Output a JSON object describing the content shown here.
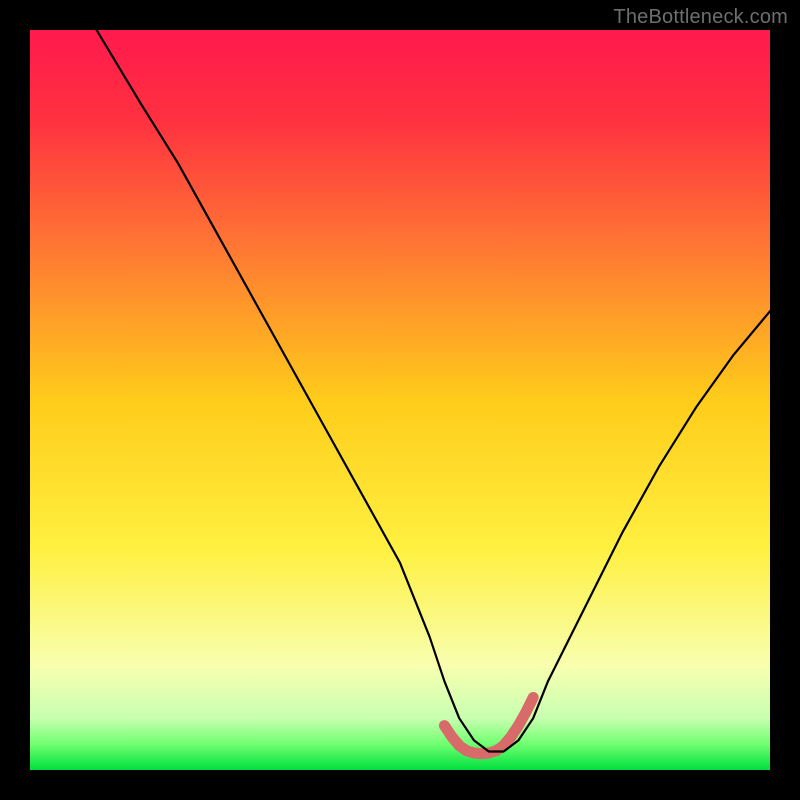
{
  "watermark": "TheBottleneck.com",
  "chart_data": {
    "type": "line",
    "title": "",
    "xlabel": "",
    "ylabel": "",
    "xlim": [
      0,
      100
    ],
    "ylim": [
      0,
      100
    ],
    "series": [
      {
        "name": "bottleneck-curve",
        "x": [
          9,
          15,
          20,
          25,
          30,
          35,
          40,
          45,
          50,
          54,
          56,
          58,
          60,
          62,
          64,
          66,
          68,
          70,
          75,
          80,
          85,
          90,
          95,
          100
        ],
        "y": [
          100,
          90,
          82,
          73,
          64,
          55,
          46,
          37,
          28,
          18,
          12,
          7,
          4,
          2.5,
          2.5,
          4,
          7,
          12,
          22,
          32,
          41,
          49,
          56,
          62
        ]
      },
      {
        "name": "optimal-range-marker",
        "x": [
          56,
          57,
          58,
          59,
          60,
          61,
          62,
          63,
          64,
          65,
          66,
          67,
          68
        ],
        "y": [
          6.0,
          4.5,
          3.3,
          2.6,
          2.3,
          2.2,
          2.3,
          2.6,
          3.3,
          4.5,
          6.0,
          7.8,
          9.8
        ]
      }
    ],
    "gradient_stops": [
      {
        "pct": 0,
        "color": "#ff1a4d"
      },
      {
        "pct": 12,
        "color": "#ff3040"
      },
      {
        "pct": 30,
        "color": "#ff7a33"
      },
      {
        "pct": 50,
        "color": "#ffcc1a"
      },
      {
        "pct": 70,
        "color": "#fff040"
      },
      {
        "pct": 86,
        "color": "#f8ffb0"
      },
      {
        "pct": 93,
        "color": "#c8ffb0"
      },
      {
        "pct": 96.5,
        "color": "#70ff70"
      },
      {
        "pct": 100,
        "color": "#00e040"
      }
    ],
    "curve_color": "#000000",
    "marker_color": "#d96a6a"
  }
}
